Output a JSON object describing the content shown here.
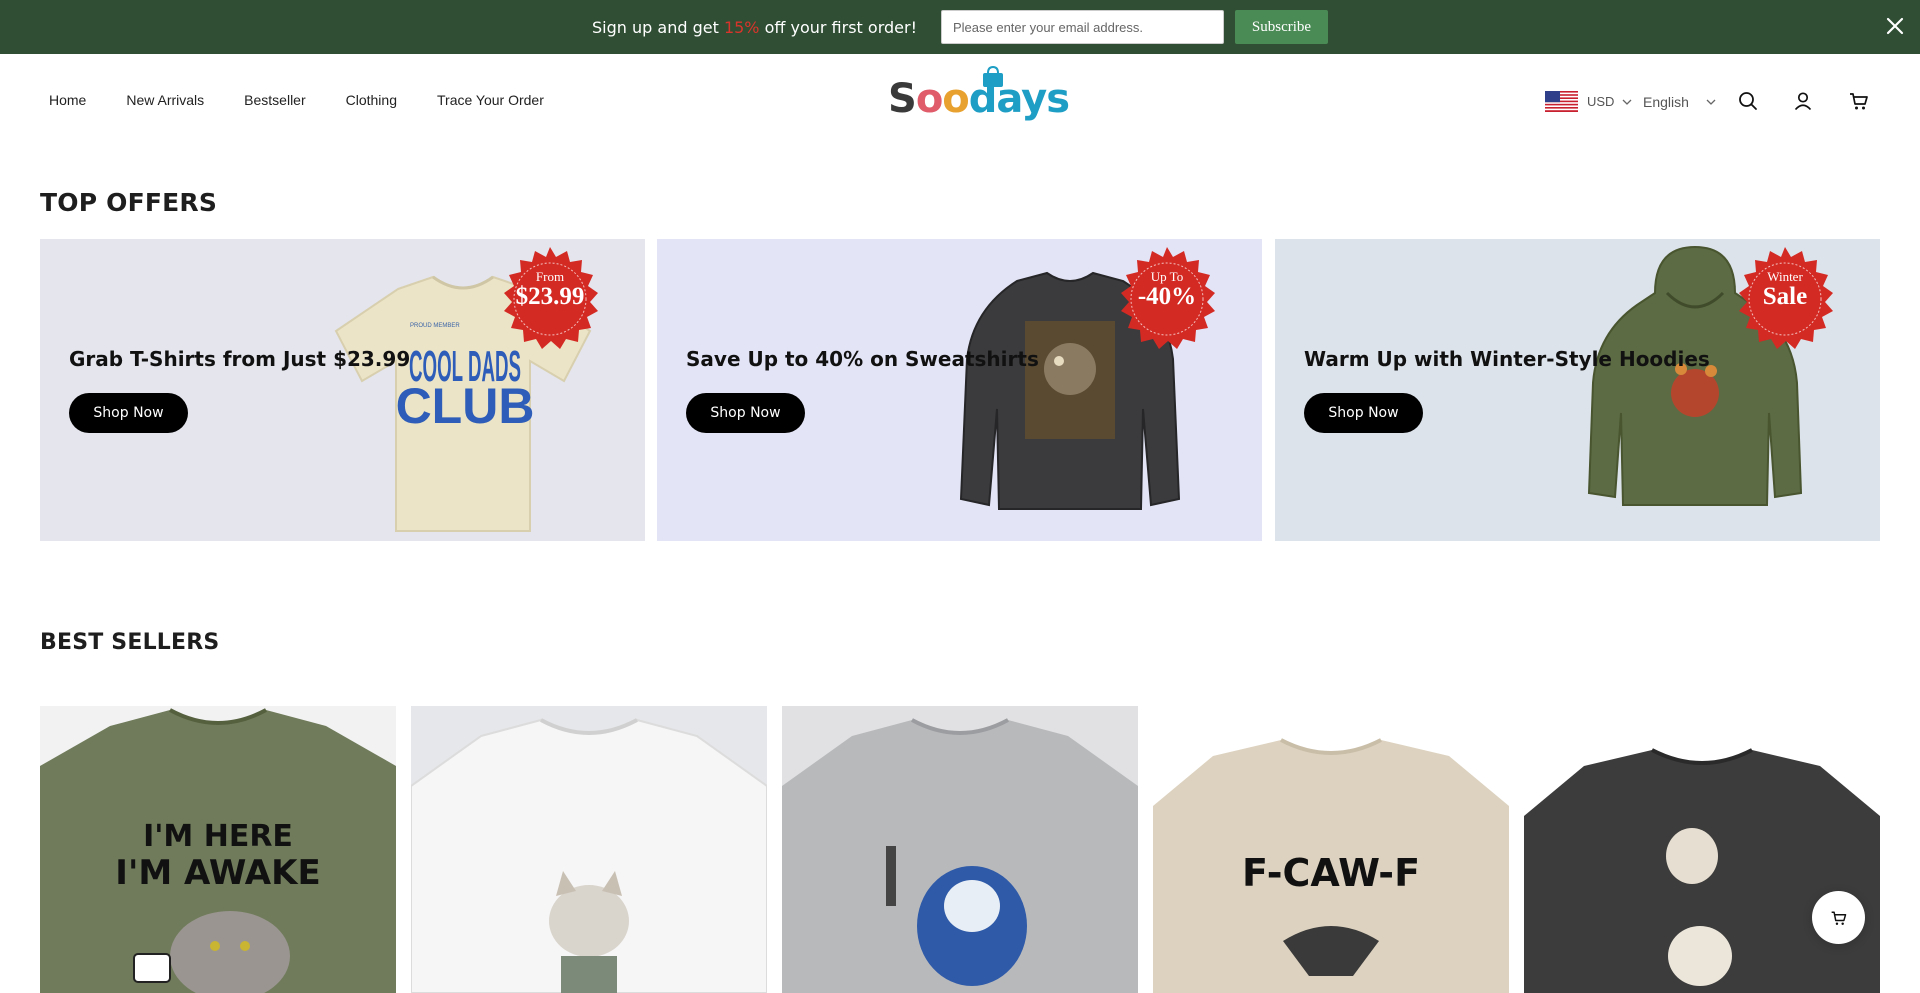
{
  "announcement": {
    "text_before": "Sign up and get ",
    "highlight": "15%",
    "text_after": " off your first order!",
    "email_placeholder": "Please enter your email address.",
    "subscribe_label": "Subscribe",
    "close_icon": "close-icon"
  },
  "header": {
    "nav": [
      "Home",
      "New Arrivals",
      "Bestseller",
      "Clothing",
      "Trace Your Order"
    ],
    "logo": "Soodays",
    "currency": "USD",
    "language": "English",
    "icons": [
      "us-flag-icon",
      "search-icon",
      "account-icon",
      "cart-icon"
    ]
  },
  "top_offers": {
    "title": "TOP OFFERS",
    "cards": [
      {
        "title": "Grab T-Shirts from Just $23.99",
        "button": "Shop Now",
        "badge_top": "From",
        "badge_main": "$23.99",
        "bg": "#e4e5ed",
        "print_top": "PROUD MEMBER",
        "print_main": "COOL DADS",
        "print_main2": "CLUB"
      },
      {
        "title": "Save Up to 40% on Sweatshirts",
        "button": "Shop Now",
        "badge_top": "Up To",
        "badge_main": "-40%",
        "bg": "#e3e4f6"
      },
      {
        "title": "Warm Up with Winter-Style Hoodies",
        "button": "Shop Now",
        "badge_top": "Winter",
        "badge_main": "Sale",
        "bg": "#dde3ea"
      }
    ]
  },
  "best_sellers": {
    "title": "BEST SELLERS",
    "products": [
      {
        "shirt_color": "#6f7b5a",
        "print_line1": "I'M HERE",
        "print_line2": "I'M AWAKE"
      },
      {
        "shirt_color": "#f3f3f3"
      },
      {
        "shirt_color": "#b8b9bb"
      },
      {
        "shirt_color": "#ddd2bf",
        "print_line1": "F-CAW-F"
      },
      {
        "shirt_color": "#3c3c3c"
      }
    ]
  },
  "colors": {
    "announce_bg": "#2f4e34",
    "subscribe_bg": "#4a8a54",
    "badge_red": "#d42a24",
    "button_black": "#000000"
  }
}
